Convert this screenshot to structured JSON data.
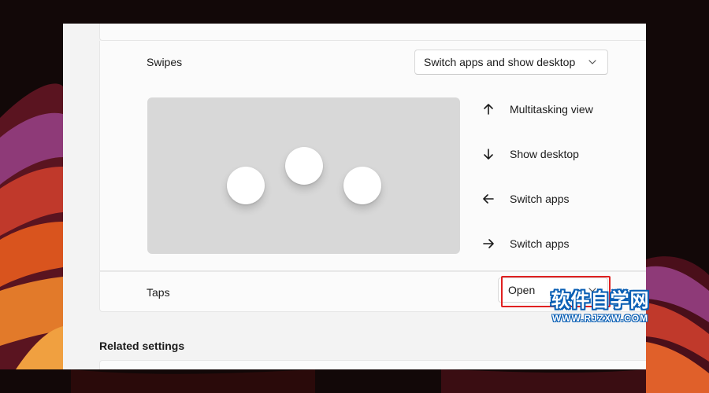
{
  "colors": {
    "wallpaper_base": "#120808",
    "window_bg": "#f3f3f3",
    "card_bg": "#fbfbfb",
    "preview_bg": "#d8d8d8",
    "highlight_red": "#e02020",
    "watermark_blue": "#0a5fb4"
  },
  "swipes": {
    "label": "Swipes",
    "dropdown_value": "Switch apps and show desktop",
    "dropdown_icon": "chevron-down-icon",
    "gestures": [
      {
        "icon": "arrow-up-icon",
        "label": "Multitasking view"
      },
      {
        "icon": "arrow-down-icon",
        "label": "Show desktop"
      },
      {
        "icon": "arrow-left-icon",
        "label": "Switch apps"
      },
      {
        "icon": "arrow-right-icon",
        "label": "Switch apps"
      }
    ]
  },
  "taps": {
    "label": "Taps",
    "dropdown_value": "Open",
    "dropdown_icon": "chevron-down-icon"
  },
  "related_settings": {
    "title": "Related settings"
  },
  "watermark": {
    "main": "软件自学网",
    "sub": "WWW.RJZXW.COM"
  }
}
